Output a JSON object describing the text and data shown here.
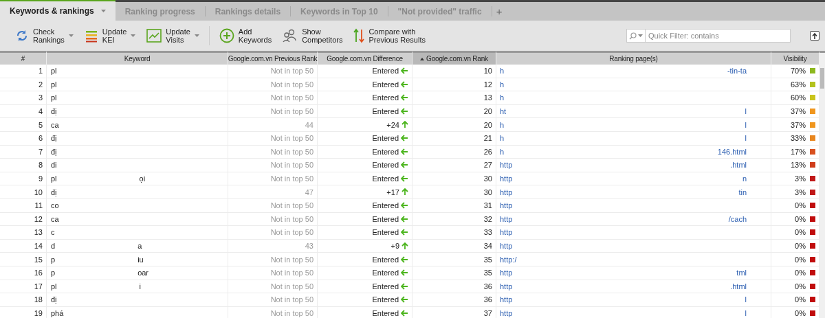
{
  "tabs": [
    {
      "label": "Keywords & rankings",
      "selected": true,
      "dropdown": true
    },
    {
      "label": "Ranking progress",
      "selected": false,
      "dropdown": false
    },
    {
      "label": "Rankings details",
      "selected": false,
      "dropdown": false
    },
    {
      "label": "Keywords in Top 10",
      "selected": false,
      "dropdown": false
    },
    {
      "label": "\"Not provided\" traffic",
      "selected": false,
      "dropdown": false
    }
  ],
  "add_tab": "+",
  "toolbar": [
    {
      "lines": [
        "Check",
        "Rankings"
      ],
      "dropdown": true
    },
    {
      "lines": [
        "Update",
        "KEI"
      ],
      "dropdown": true
    },
    {
      "lines": [
        "Update",
        "Visits"
      ],
      "dropdown": true
    },
    {
      "lines": [
        "Add",
        "Keywords"
      ],
      "dropdown": false
    },
    {
      "lines": [
        "Show",
        "Competitors"
      ],
      "dropdown": false
    },
    {
      "lines": [
        "Compare with",
        "Previous Results"
      ],
      "dropdown": false
    }
  ],
  "filter": {
    "placeholder": "Quick Filter: contains"
  },
  "table": {
    "columns": [
      {
        "label": "#",
        "sorted": false
      },
      {
        "label": "Keyword",
        "sorted": false
      },
      {
        "label": "Google.com.vn Previous Rank",
        "sorted": false
      },
      {
        "label": "Google.com.vn Difference",
        "sorted": false
      },
      {
        "label": "Google.com.vn Rank",
        "sorted": true
      },
      {
        "label": "Ranking page(s)",
        "sorted": false
      },
      {
        "label": "Visibility",
        "sorted": false
      }
    ],
    "rows": [
      {
        "n": "1",
        "keyword": "pl",
        "prev": "Not in top 50",
        "diff": "Entered",
        "kind": "entered",
        "rank": "10",
        "page": "h",
        "page_tail": "-tin-ta",
        "visibility": "70%",
        "color": "#8db81e"
      },
      {
        "n": "2",
        "keyword": "pl",
        "prev": "Not in top 50",
        "diff": "Entered",
        "kind": "entered",
        "rank": "12",
        "page": "h",
        "visibility": "63%",
        "color": "#b3c21c"
      },
      {
        "n": "3",
        "keyword": "pl",
        "prev": "Not in top 50",
        "diff": "Entered",
        "kind": "entered",
        "rank": "13",
        "page": "h",
        "visibility": "60%",
        "color": "#c9c41c"
      },
      {
        "n": "4",
        "keyword": "đị",
        "prev": "Not in top 50",
        "diff": "Entered",
        "kind": "entered",
        "rank": "20",
        "page": "ht",
        "page_tail": "l",
        "visibility": "37%",
        "color": "#f0961e"
      },
      {
        "n": "5",
        "keyword": "ca",
        "prev": "44",
        "diff": "+24",
        "kind": "up",
        "rank": "20",
        "page": "h",
        "page_tail": "l",
        "visibility": "37%",
        "color": "#f0961e"
      },
      {
        "n": "6",
        "keyword": "đị",
        "prev": "Not in top 50",
        "diff": "Entered",
        "kind": "entered",
        "rank": "21",
        "page": "h",
        "page_tail": "l",
        "visibility": "33%",
        "color": "#e8861e"
      },
      {
        "n": "7",
        "keyword": "đị",
        "prev": "Not in top 50",
        "diff": "Entered",
        "kind": "entered",
        "rank": "26",
        "page": "h",
        "page_tail": "146.html",
        "visibility": "17%",
        "color": "#d8501e"
      },
      {
        "n": "8",
        "keyword": "di",
        "prev": "Not in top 50",
        "diff": "Entered",
        "kind": "entered",
        "rank": "27",
        "page": "http",
        "page_tail": ".html",
        "visibility": "13%",
        "color": "#cf3c1a"
      },
      {
        "n": "9",
        "keyword": "pl",
        "keyword_tail": "ọi",
        "prev": "Not in top 50",
        "diff": "Entered",
        "kind": "entered",
        "rank": "30",
        "page": "http",
        "page_tail": "n",
        "visibility": "3%",
        "color": "#c01818"
      },
      {
        "n": "10",
        "keyword": "đị",
        "prev": "47",
        "diff": "+17",
        "kind": "up",
        "rank": "30",
        "page": "http",
        "page_tail": "tin",
        "visibility": "3%",
        "color": "#c01818"
      },
      {
        "n": "11",
        "keyword": "co",
        "prev": "Not in top 50",
        "diff": "Entered",
        "kind": "entered",
        "rank": "31",
        "page": "http",
        "visibility": "0%",
        "color": "#c00c0c"
      },
      {
        "n": "12",
        "keyword": "ca",
        "prev": "Not in top 50",
        "diff": "Entered",
        "kind": "entered",
        "rank": "32",
        "page": "http",
        "page_tail": "/cach",
        "visibility": "0%",
        "color": "#c00c0c"
      },
      {
        "n": "13",
        "keyword": "c",
        "prev": "Not in top 50",
        "diff": "Entered",
        "kind": "entered",
        "rank": "33",
        "page": "http",
        "visibility": "0%",
        "color": "#c00c0c"
      },
      {
        "n": "14",
        "keyword": "d",
        "keyword_tail": "a",
        "prev": "43",
        "diff": "+9",
        "kind": "up",
        "rank": "34",
        "page": "http",
        "visibility": "0%",
        "color": "#c00c0c"
      },
      {
        "n": "15",
        "keyword": "p",
        "keyword_tail": "iu",
        "prev": "Not in top 50",
        "diff": "Entered",
        "kind": "entered",
        "rank": "35",
        "page": "http:/",
        "visibility": "0%",
        "color": "#c00c0c"
      },
      {
        "n": "16",
        "keyword": "p",
        "keyword_tail": "oar",
        "prev": "Not in top 50",
        "diff": "Entered",
        "kind": "entered",
        "rank": "35",
        "page": "http",
        "page_tail": "tml",
        "visibility": "0%",
        "color": "#c00c0c"
      },
      {
        "n": "17",
        "keyword": "pl",
        "keyword_tail": "i",
        "prev": "Not in top 50",
        "diff": "Entered",
        "kind": "entered",
        "rank": "36",
        "page": "http",
        "page_tail": ".html",
        "visibility": "0%",
        "color": "#c00c0c"
      },
      {
        "n": "18",
        "keyword": "đị",
        "prev": "Not in top 50",
        "diff": "Entered",
        "kind": "entered",
        "rank": "36",
        "page": "http",
        "page_tail": "l",
        "visibility": "0%",
        "color": "#c00c0c"
      },
      {
        "n": "19",
        "keyword": "phá",
        "prev": "Not in top 50",
        "diff": "Entered",
        "kind": "entered",
        "rank": "37",
        "page": "http",
        "page_tail": "l",
        "visibility": "0%",
        "color": "#c00c0c"
      }
    ]
  }
}
